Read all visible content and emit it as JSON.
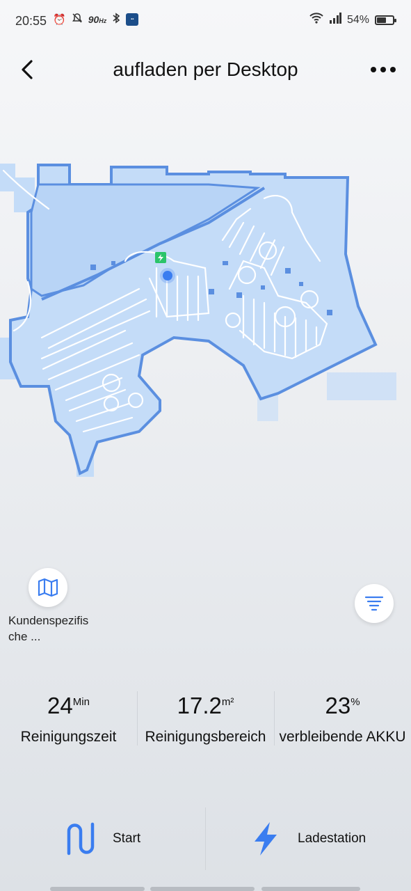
{
  "status_bar": {
    "time": "20:55",
    "refresh_rate": "90",
    "refresh_rate_unit": "Hz",
    "battery_percent": "54%",
    "battery_level": 0.54
  },
  "header": {
    "title": "aufladen per Desktop"
  },
  "controls": {
    "custom_label": "Kundenspezifische ..."
  },
  "stats": {
    "time": {
      "value": "24",
      "unit": "Min",
      "label": "Reinigungszeit"
    },
    "area": {
      "value": "17.2",
      "unit": "m²",
      "label": "Reinigungsbereich"
    },
    "battery": {
      "value": "23",
      "unit": "%",
      "label": "verbleibende AKKU"
    }
  },
  "actions": {
    "start_label": "Start",
    "dock_label": "Ladestation"
  },
  "colors": {
    "map_fill": "#c4dcf8",
    "map_wall": "#5b8fe0",
    "accent": "#3a7df0",
    "dock_green": "#2bc46a"
  }
}
